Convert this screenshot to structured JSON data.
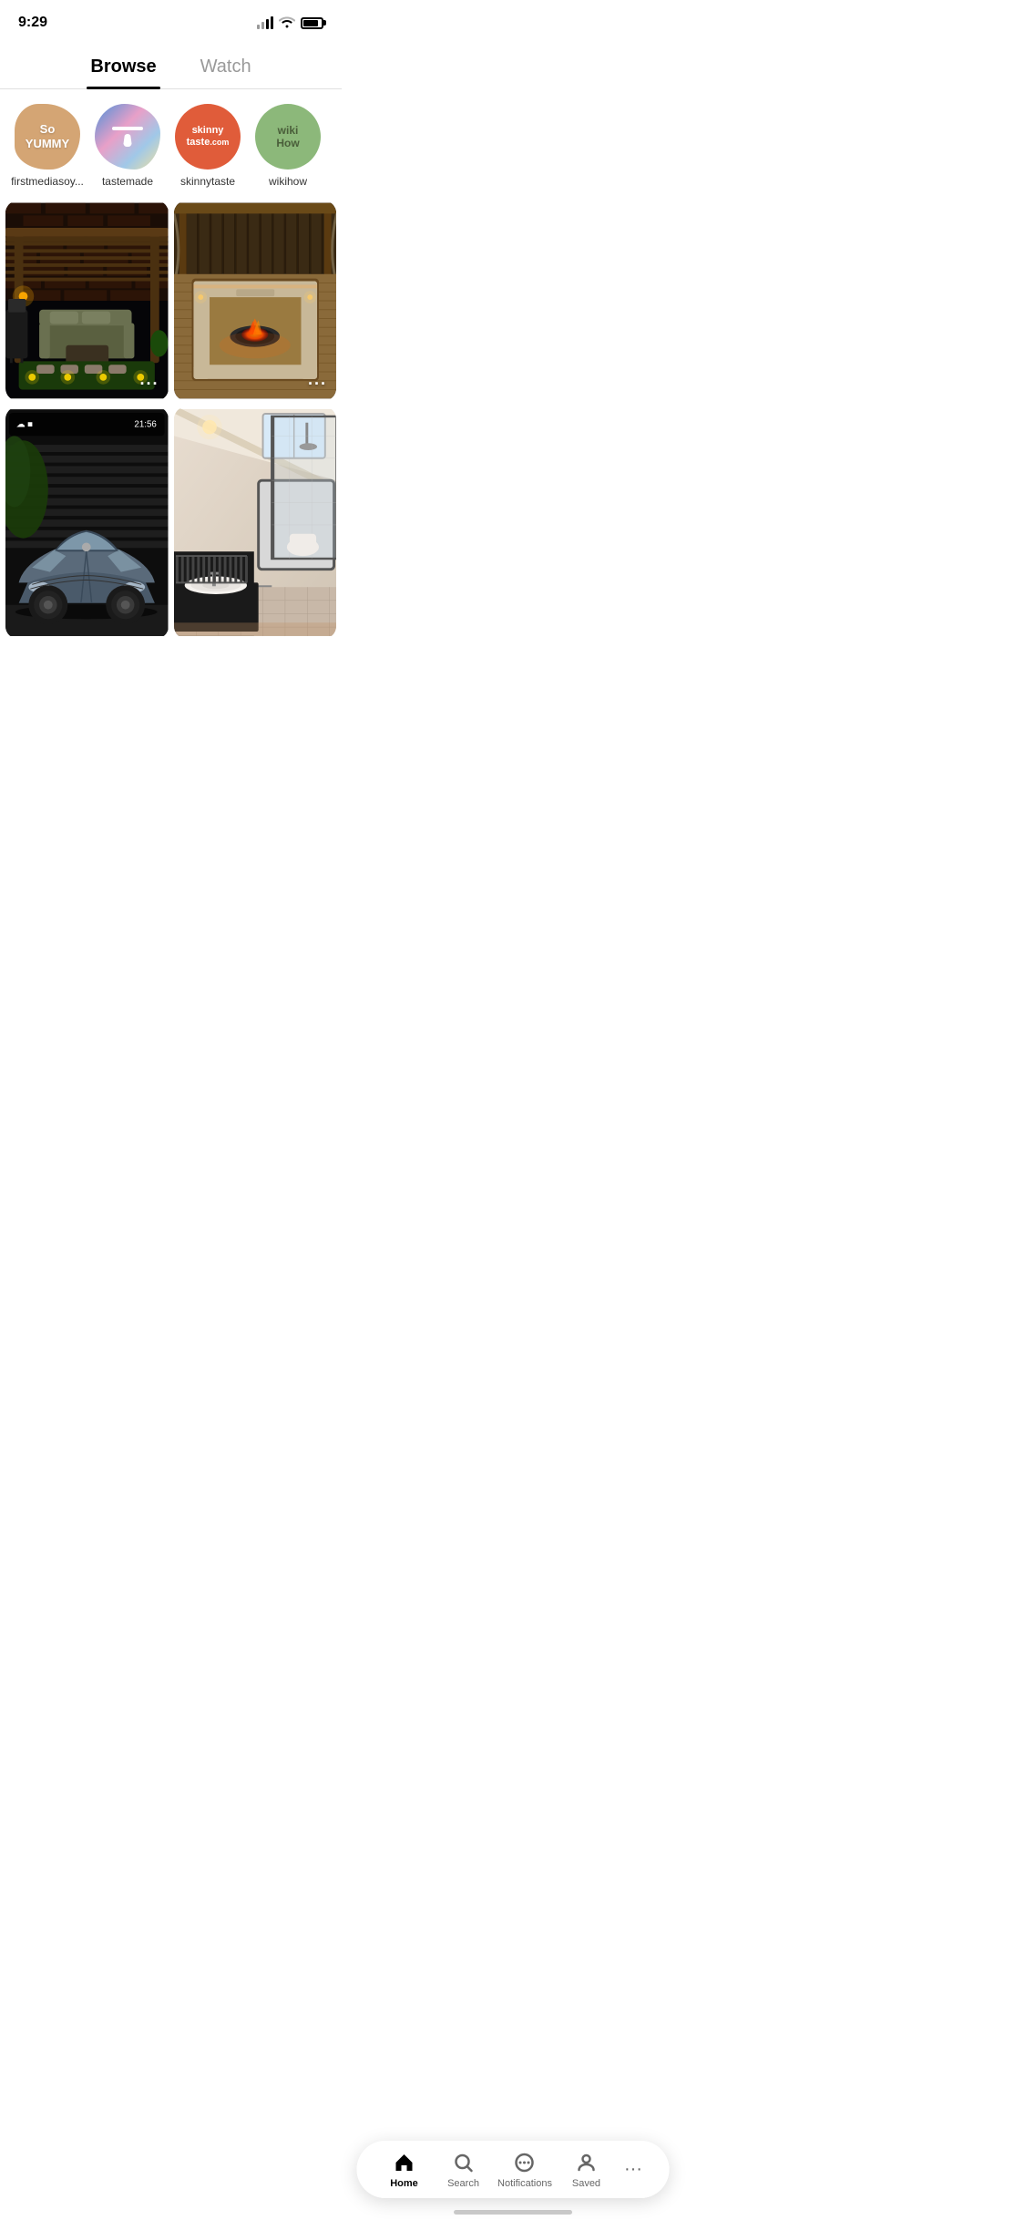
{
  "statusBar": {
    "time": "9:29",
    "signal": 2,
    "battery": 85
  },
  "tabs": [
    {
      "id": "browse",
      "label": "Browse",
      "active": true
    },
    {
      "id": "watch",
      "label": "Watch",
      "active": false
    }
  ],
  "channels": [
    {
      "id": "firstmediasoy",
      "name": "firstmediasoy...",
      "avatarType": "soyummy",
      "text1": "So",
      "text2": "YUMMY"
    },
    {
      "id": "tastemade",
      "name": "tastemade",
      "avatarType": "tastemade"
    },
    {
      "id": "skinnytaste",
      "name": "skinnytaste",
      "avatarType": "skinnytaste",
      "text1": "skinny",
      "text2": "taste."
    },
    {
      "id": "wikihow",
      "name": "wikihow",
      "avatarType": "wikihow",
      "text1": "wiki",
      "text2": "How"
    }
  ],
  "pins": {
    "column1": [
      {
        "id": "patio1",
        "type": "patio-night",
        "hasMore": true
      },
      {
        "id": "car",
        "type": "car",
        "hasMore": false
      }
    ],
    "column2": [
      {
        "id": "patio2",
        "type": "firepit",
        "hasMore": true
      },
      {
        "id": "bathroom",
        "type": "bathroom",
        "hasMore": false
      }
    ]
  },
  "bottomNav": {
    "items": [
      {
        "id": "home",
        "label": "Home",
        "icon": "home",
        "active": true
      },
      {
        "id": "search",
        "label": "Search",
        "icon": "search",
        "active": false
      },
      {
        "id": "notifications",
        "label": "Notifications",
        "icon": "chat",
        "active": false
      },
      {
        "id": "saved",
        "label": "Saved",
        "icon": "person",
        "active": false
      }
    ],
    "moreLabel": "···"
  },
  "moreIcon": "···"
}
